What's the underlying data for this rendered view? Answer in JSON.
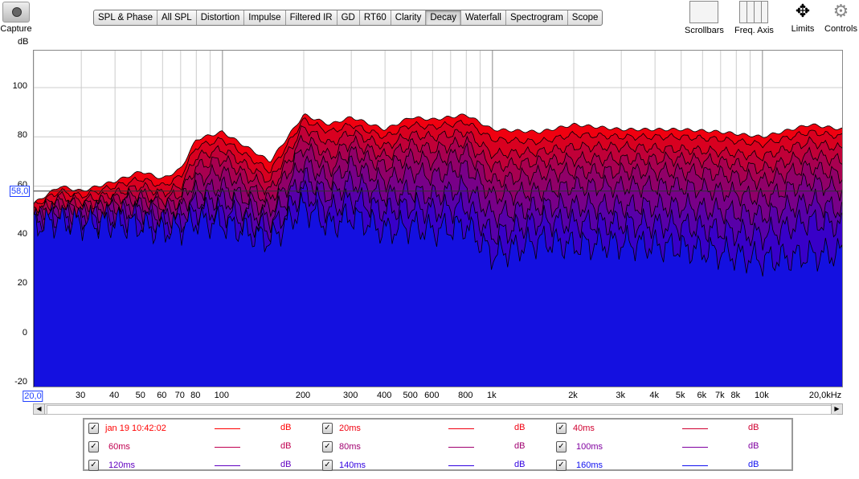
{
  "toolbar": {
    "capture": "Capture",
    "tabs": [
      "SPL & Phase",
      "All SPL",
      "Distortion",
      "Impulse",
      "Filtered IR",
      "GD",
      "RT60",
      "Clarity",
      "Decay",
      "Waterfall",
      "Spectrogram",
      "Scope"
    ],
    "active_tab": "Decay",
    "right": [
      "Scrollbars",
      "Freq. Axis",
      "Limits",
      "Controls"
    ]
  },
  "legend": [
    {
      "label": "jan 19 10:42:02",
      "unit": "dB",
      "color": "#ff0000",
      "checked": true
    },
    {
      "label": "20ms",
      "unit": "dB",
      "color": "#f00010",
      "checked": true
    },
    {
      "label": "40ms",
      "unit": "dB",
      "color": "#d00030",
      "checked": true
    },
    {
      "label": "60ms",
      "unit": "dB",
      "color": "#c00050",
      "checked": true
    },
    {
      "label": "80ms",
      "unit": "dB",
      "color": "#a00070",
      "checked": true
    },
    {
      "label": "100ms",
      "unit": "dB",
      "color": "#8000a0",
      "checked": true
    },
    {
      "label": "120ms",
      "unit": "dB",
      "color": "#6000c0",
      "checked": true
    },
    {
      "label": "140ms",
      "unit": "dB",
      "color": "#3000e0",
      "checked": true
    },
    {
      "label": "160ms",
      "unit": "dB",
      "color": "#1010f0",
      "checked": true
    }
  ],
  "chart_data": {
    "type": "area",
    "ylabel": "dB",
    "xlim": [
      20,
      20000
    ],
    "ylim": [
      -22,
      115
    ],
    "xscale": "log",
    "grid": true,
    "yticks": [
      "100",
      "80",
      "60",
      "40",
      "20",
      "0",
      "-20"
    ],
    "xticks": [
      {
        "v": 20,
        "t": "20,0"
      },
      {
        "v": 30,
        "t": "30"
      },
      {
        "v": 40,
        "t": "40"
      },
      {
        "v": 50,
        "t": "50"
      },
      {
        "v": 60,
        "t": "60"
      },
      {
        "v": 70,
        "t": "70"
      },
      {
        "v": 80,
        "t": "80"
      },
      {
        "v": 100,
        "t": "100"
      },
      {
        "v": 200,
        "t": "200"
      },
      {
        "v": 300,
        "t": "300"
      },
      {
        "v": 400,
        "t": "400"
      },
      {
        "v": 500,
        "t": "500"
      },
      {
        "v": 600,
        "t": "600"
      },
      {
        "v": 800,
        "t": "800"
      },
      {
        "v": 1000,
        "t": "1k"
      },
      {
        "v": 2000,
        "t": "2k"
      },
      {
        "v": 3000,
        "t": "3k"
      },
      {
        "v": 4000,
        "t": "4k"
      },
      {
        "v": 5000,
        "t": "5k"
      },
      {
        "v": 6000,
        "t": "6k"
      },
      {
        "v": 7000,
        "t": "7k"
      },
      {
        "v": 8000,
        "t": "8k"
      },
      {
        "v": 10000,
        "t": "10k"
      },
      {
        "v": 20000,
        "t": "20,0kHz"
      }
    ],
    "cursor_db": "58,0",
    "x": [
      20,
      25,
      30,
      40,
      50,
      60,
      70,
      80,
      100,
      150,
      200,
      250,
      300,
      400,
      500,
      600,
      800,
      1000,
      1500,
      2000,
      3000,
      5000,
      7000,
      10000,
      15000,
      20000
    ],
    "series": [
      {
        "name": "jan 19 10:42:02",
        "values": [
          53,
          60,
          58,
          62,
          66,
          63,
          67,
          79,
          82,
          70,
          89,
          85,
          88,
          83,
          88,
          87,
          89,
          83,
          82,
          85,
          83,
          83,
          82,
          80,
          85,
          83
        ]
      },
      {
        "name": "20ms",
        "values": [
          52,
          58,
          56,
          60,
          63,
          60,
          64,
          76,
          79,
          66,
          87,
          82,
          85,
          80,
          85,
          84,
          86,
          79,
          78,
          81,
          80,
          80,
          79,
          77,
          82,
          80
        ]
      },
      {
        "name": "40ms",
        "values": [
          50,
          56,
          54,
          57,
          60,
          57,
          60,
          72,
          75,
          62,
          84,
          77,
          82,
          76,
          81,
          80,
          82,
          73,
          74,
          76,
          76,
          75,
          74,
          72,
          78,
          75
        ]
      },
      {
        "name": "60ms",
        "values": [
          49,
          54,
          52,
          55,
          57,
          54,
          57,
          68,
          71,
          58,
          80,
          72,
          78,
          72,
          77,
          75,
          78,
          68,
          70,
          71,
          71,
          71,
          70,
          67,
          73,
          70
        ]
      },
      {
        "name": "80ms",
        "values": [
          48,
          52,
          50,
          53,
          55,
          52,
          54,
          63,
          66,
          54,
          76,
          67,
          74,
          68,
          72,
          70,
          74,
          62,
          65,
          66,
          66,
          66,
          65,
          62,
          68,
          64
        ]
      },
      {
        "name": "100ms",
        "values": [
          47,
          50,
          49,
          51,
          52,
          50,
          51,
          58,
          60,
          50,
          70,
          62,
          69,
          62,
          66,
          64,
          68,
          56,
          58,
          60,
          60,
          60,
          58,
          55,
          62,
          58
        ]
      },
      {
        "name": "120ms",
        "values": [
          46,
          49,
          47,
          49,
          50,
          47,
          48,
          54,
          55,
          46,
          64,
          56,
          62,
          56,
          58,
          56,
          60,
          48,
          52,
          52,
          52,
          52,
          50,
          48,
          54,
          50
        ]
      },
      {
        "name": "140ms",
        "values": [
          45,
          47,
          46,
          47,
          47,
          45,
          45,
          50,
          50,
          42,
          58,
          50,
          55,
          50,
          52,
          50,
          52,
          40,
          46,
          45,
          45,
          44,
          42,
          40,
          46,
          44
        ]
      },
      {
        "name": "160ms",
        "values": [
          44,
          46,
          45,
          45,
          44,
          42,
          43,
          46,
          45,
          38,
          52,
          44,
          48,
          42,
          44,
          42,
          44,
          32,
          38,
          36,
          37,
          35,
          33,
          30,
          32,
          33
        ]
      }
    ],
    "fill_colors": [
      "#f00010",
      "#d80020",
      "#c00038",
      "#a80050",
      "#900068",
      "#780088",
      "#5800a8",
      "#3800c8",
      "#1410e0"
    ]
  }
}
